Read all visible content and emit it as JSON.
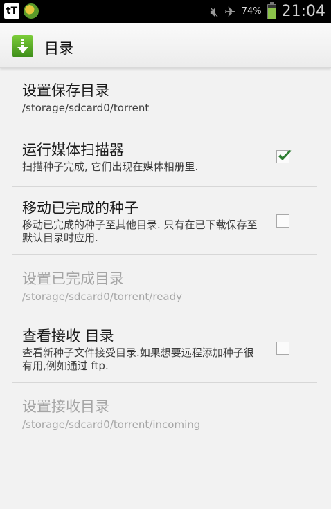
{
  "status_bar": {
    "app_icon_text": "tT",
    "battery_percent": "74%",
    "battery_level": 0.74,
    "time": "21:04"
  },
  "action_bar": {
    "title": "目录"
  },
  "settings": [
    {
      "title": "设置保存目录",
      "summary": "/storage/sdcard0/torrent",
      "enabled": true
    },
    {
      "title": "运行媒体扫描器",
      "summary": "扫描种子完成, 它们出现在媒体相册里.",
      "checked": true,
      "enabled": true
    },
    {
      "title": "移动已完成的种子",
      "summary": "移动已完成的种子至其他目录. 只有在已下载保存至默认目录时应用.",
      "checked": false,
      "enabled": true
    },
    {
      "title": "设置已完成目录",
      "summary": "/storage/sdcard0/torrent/ready",
      "enabled": false
    },
    {
      "title": "查看接收 目录",
      "summary": "查看新种子文件接受目录.如果想要远程添加种子很有用,例如通过 ftp.",
      "checked": false,
      "enabled": true
    },
    {
      "title": "设置接收目录",
      "summary": "/storage/sdcard0/torrent/incoming",
      "enabled": false
    }
  ],
  "icons": {
    "app": "download-arrow-icon",
    "checked": "checkmark-icon"
  }
}
